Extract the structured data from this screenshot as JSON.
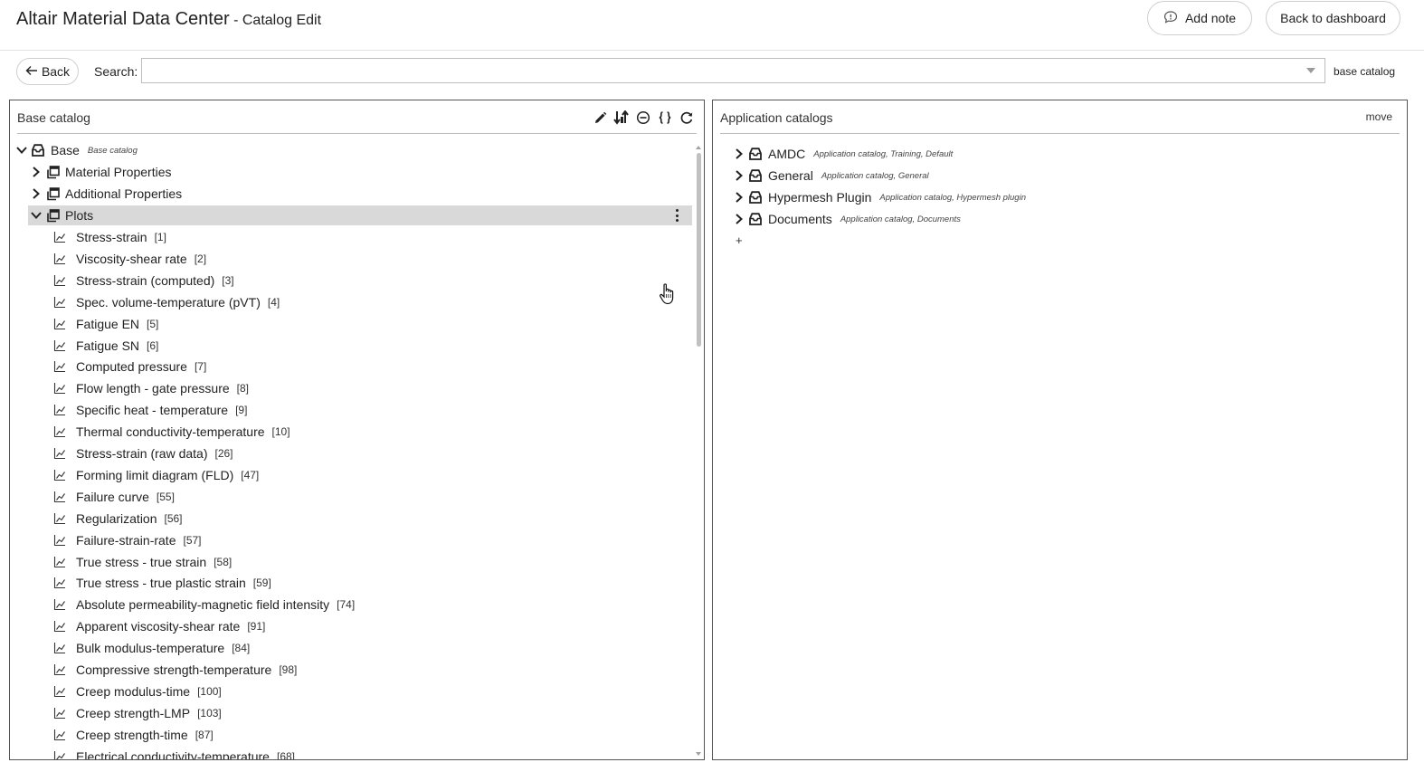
{
  "header": {
    "app_name": "Altair Material Data Center",
    "page_suffix": " - Catalog Edit",
    "add_note_label": "Add note",
    "back_to_dashboard_label": "Back to dashboard"
  },
  "toolbar": {
    "back_label": "Back",
    "search_label": "Search:",
    "search_value": "",
    "scope_label": "base catalog"
  },
  "left_panel": {
    "title": "Base catalog",
    "tools": [
      "pencil-icon",
      "sort-icon",
      "minus-circle-icon",
      "braces-icon",
      "refresh-icon"
    ],
    "root": {
      "label": "Base",
      "tag": "Base catalog"
    },
    "groups": [
      {
        "label": "Material Properties",
        "expanded": false
      },
      {
        "label": "Additional Properties",
        "expanded": false
      },
      {
        "label": "Plots",
        "expanded": true,
        "selected": true
      }
    ],
    "plots": [
      {
        "label": "Stress-strain",
        "idx": "[1]"
      },
      {
        "label": "Viscosity-shear rate",
        "idx": "[2]"
      },
      {
        "label": "Stress-strain (computed)",
        "idx": "[3]"
      },
      {
        "label": "Spec. volume-temperature (pVT)",
        "idx": "[4]"
      },
      {
        "label": "Fatigue EN",
        "idx": "[5]"
      },
      {
        "label": "Fatigue SN",
        "idx": "[6]"
      },
      {
        "label": "Computed pressure",
        "idx": "[7]"
      },
      {
        "label": "Flow length - gate pressure",
        "idx": "[8]"
      },
      {
        "label": "Specific heat - temperature",
        "idx": "[9]"
      },
      {
        "label": "Thermal conductivity-temperature",
        "idx": "[10]"
      },
      {
        "label": "Stress-strain (raw data)",
        "idx": "[26]"
      },
      {
        "label": "Forming limit diagram (FLD)",
        "idx": "[47]"
      },
      {
        "label": "Failure curve",
        "idx": "[55]"
      },
      {
        "label": "Regularization",
        "idx": "[56]"
      },
      {
        "label": "Failure-strain-rate",
        "idx": "[57]"
      },
      {
        "label": "True stress - true strain",
        "idx": "[58]"
      },
      {
        "label": "True stress - true plastic strain",
        "idx": "[59]"
      },
      {
        "label": "Absolute permeability-magnetic field intensity",
        "idx": "[74]"
      },
      {
        "label": "Apparent viscosity-shear rate",
        "idx": "[91]"
      },
      {
        "label": "Bulk modulus-temperature",
        "idx": "[84]"
      },
      {
        "label": "Compressive strength-temperature",
        "idx": "[98]"
      },
      {
        "label": "Creep modulus-time",
        "idx": "[100]"
      },
      {
        "label": "Creep strength-LMP",
        "idx": "[103]"
      },
      {
        "label": "Creep strength-time",
        "idx": "[87]"
      },
      {
        "label": "Electrical conductivity-temperature",
        "idx": "[68]"
      }
    ]
  },
  "right_panel": {
    "title": "Application catalogs",
    "move_label": "move",
    "catalogs": [
      {
        "label": "AMDC",
        "tag": "Application catalog, Training, Default"
      },
      {
        "label": "General",
        "tag": "Application catalog, General"
      },
      {
        "label": "Hypermesh Plugin",
        "tag": "Application catalog, Hypermesh plugin"
      },
      {
        "label": "Documents",
        "tag": "Application catalog, Documents"
      }
    ],
    "add_label": "+"
  }
}
